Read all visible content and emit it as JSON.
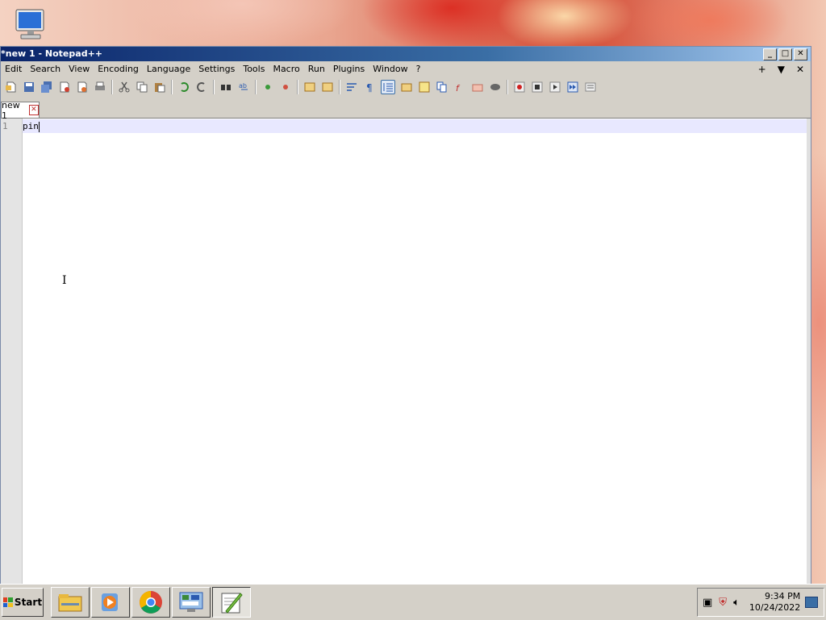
{
  "window": {
    "title": "*new 1 - Notepad++",
    "controls": {
      "minimize": "_",
      "maximize": "□",
      "close": "✕"
    }
  },
  "menubar": {
    "items": [
      "Edit",
      "Search",
      "View",
      "Encoding",
      "Language",
      "Settings",
      "Tools",
      "Macro",
      "Run",
      "Plugins",
      "Window",
      "?"
    ],
    "right": {
      "add": "+",
      "dropdown": "▼",
      "close": "✕"
    }
  },
  "tabs": [
    {
      "label": "new 1",
      "close": "✕"
    }
  ],
  "editor": {
    "line_numbers": [
      "1"
    ],
    "lines": [
      "pin"
    ]
  },
  "taskbar": {
    "start_label": "Start",
    "clock": {
      "time": "9:34 PM",
      "date": "10/24/2022"
    }
  },
  "colors": {
    "title_gradient_start": "#0a246a",
    "title_gradient_end": "#a6caf0",
    "current_line_highlight": "#e8e8ff",
    "chrome": "#d4d0c8"
  }
}
